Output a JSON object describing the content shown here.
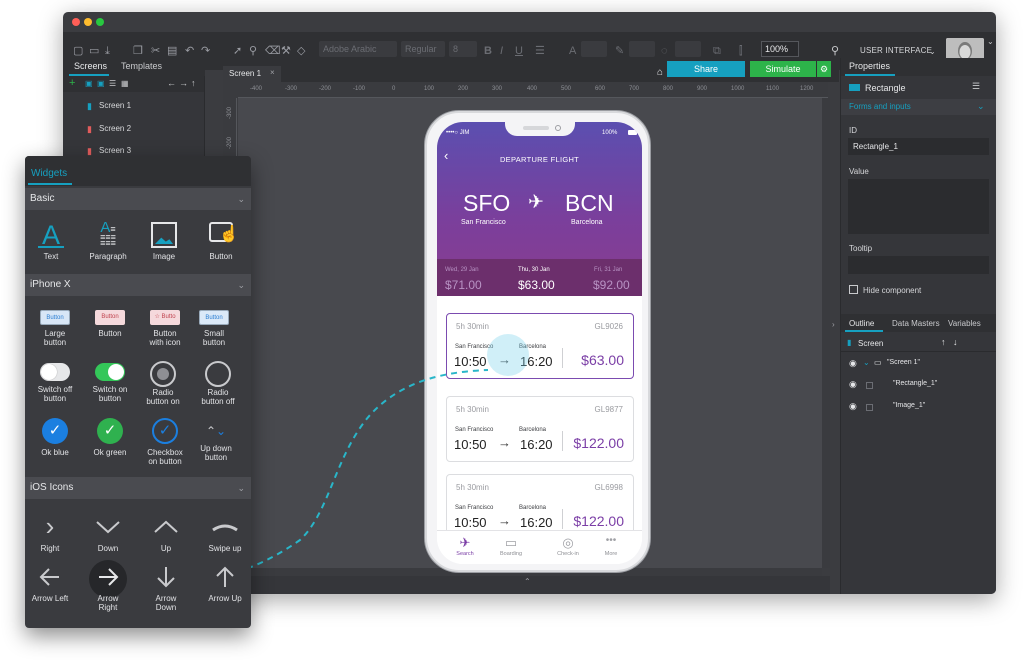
{
  "toolbar": {
    "font_family": "Adobe Arabic",
    "font_weight": "Regular",
    "font_size": "8",
    "zoom": "100%",
    "workspace": "USER INTERFACE"
  },
  "screens_panel": {
    "tabs": [
      "Screens",
      "Templates"
    ],
    "items": [
      "Screen 1",
      "Screen 2",
      "Screen 3"
    ]
  },
  "canvas": {
    "tab": "Screen 1",
    "share_label": "Share",
    "simulate_label": "Simulate",
    "ruler_h": [
      "-400",
      "-300",
      "-200",
      "-100",
      "0",
      "100",
      "200",
      "300",
      "400",
      "500",
      "600",
      "700",
      "800",
      "900",
      "1000",
      "1100",
      "1200"
    ],
    "ruler_v": [
      "-300",
      "-200"
    ]
  },
  "properties": {
    "tab": "Properties",
    "component": "Rectangle",
    "section": "Forms and inputs",
    "id_label": "ID",
    "id_value": "Rectangle_1",
    "value_label": "Value",
    "tooltip_label": "Tooltip",
    "hide_label": "Hide component",
    "outline_tabs": [
      "Outline",
      "Data Masters",
      "Variables"
    ],
    "outline_root": "Screen",
    "outline_items": [
      "\"Screen 1\"",
      "\"Rectangle_1\"",
      "\"Image_1\""
    ]
  },
  "widgets": {
    "tab": "Widgets",
    "basic_title": "Basic",
    "basic_items": [
      "Text",
      "Paragraph",
      "Image",
      "Button"
    ],
    "iphone_title": "iPhone X",
    "iphone_row1": [
      "Large\nbutton",
      "Button",
      "Button\nwith icon",
      "Small\nbutton"
    ],
    "iphone_btn_labels": [
      "Button",
      "Button",
      "Butto",
      "Button"
    ],
    "iphone_row2": [
      "Switch off\nbutton",
      "Switch on\nbutton",
      "Radio\nbutton on",
      "Radio\nbutton off"
    ],
    "iphone_row3": [
      "Ok blue",
      "Ok green",
      "Checkbox\non button",
      "Up down\nbutton"
    ],
    "ios_title": "iOS Icons",
    "ios_row1": [
      "Right",
      "Down",
      "Up",
      "Swipe up"
    ],
    "ios_row2": [
      "Arrow Left",
      "Arrow\nRight",
      "Arrow\nDown",
      "Arrow Up"
    ]
  },
  "phone": {
    "carrier": "••••○ JIM",
    "battery": "100%",
    "header": "DEPARTURE FLIGHT",
    "from_code": "SFO",
    "from_city": "San Francisco",
    "to_code": "BCN",
    "to_city": "Barcelona",
    "dates": [
      {
        "day": "Wed, 29 Jan",
        "price": "$71.00"
      },
      {
        "day": "Thu, 30 Jan",
        "price": "$63.00"
      },
      {
        "day": "Fri, 31 Jan",
        "price": "$92.00"
      }
    ],
    "flights": [
      {
        "duration": "5h 30min",
        "code": "GL9026",
        "from": "San Francisco",
        "to": "Barcelona",
        "depart": "10:50",
        "arrive": "16:20",
        "price": "$63.00"
      },
      {
        "duration": "5h 30min",
        "code": "GL9877",
        "from": "San Francisco",
        "to": "Barcelona",
        "depart": "10:50",
        "arrive": "16:20",
        "price": "$122.00"
      },
      {
        "duration": "5h 30min",
        "code": "GL6998",
        "from": "San Francisco",
        "to": "Barcelona",
        "depart": "10:50",
        "arrive": "16:20",
        "price": "$122.00"
      }
    ],
    "tabs": [
      "Search",
      "Boarding",
      "Check-in",
      "More"
    ]
  },
  "colors": {
    "accent_teal": "#16a0c0",
    "simulate_green": "#2db34a",
    "flight_purple": "#7b3ea6"
  }
}
